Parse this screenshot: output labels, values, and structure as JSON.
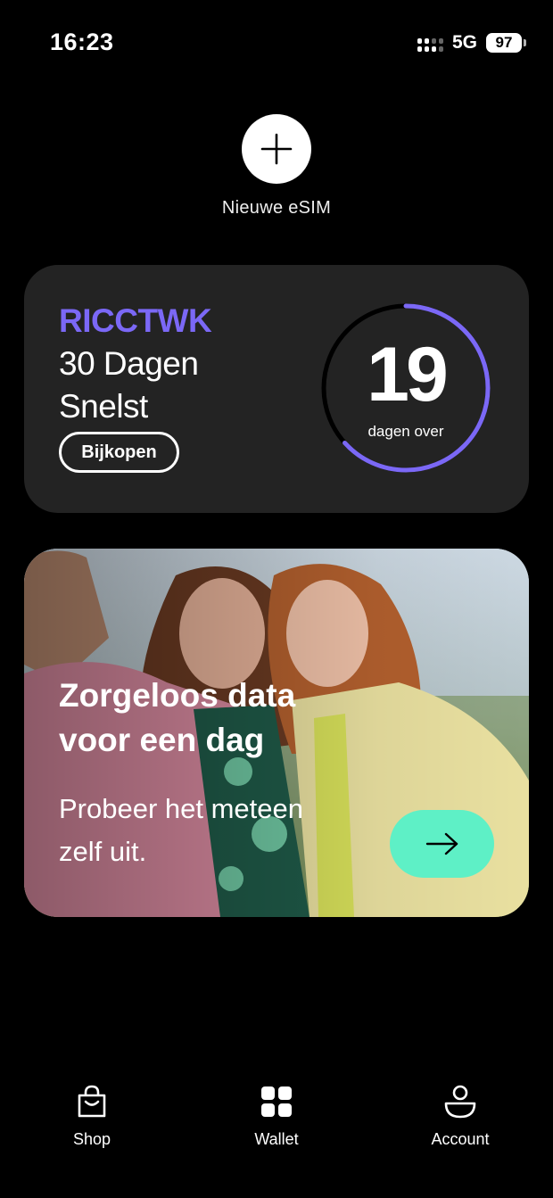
{
  "status_bar": {
    "time": "16:23",
    "network": "5G",
    "battery": "97"
  },
  "new_esim": {
    "label": "Nieuwe eSIM",
    "icon": "plus-icon"
  },
  "plan": {
    "code": "RICCTWK",
    "duration": "30 Dagen",
    "speed": "Snelst",
    "buy_label": "Bijkopen",
    "days_left": "19",
    "days_left_label": "dagen over",
    "days_total": 30,
    "accent_color": "#7b68f6"
  },
  "promo": {
    "title": "Zorgeloos data voor een dag",
    "subtitle": "Probeer het meteen zelf uit.",
    "arrow_icon": "arrow-right-icon",
    "button_color": "#5ef0c6"
  },
  "bottom_nav": {
    "items": [
      {
        "label": "Shop",
        "icon": "shopping-bag-icon"
      },
      {
        "label": "Wallet",
        "icon": "wallet-grid-icon"
      },
      {
        "label": "Account",
        "icon": "account-icon"
      }
    ]
  }
}
